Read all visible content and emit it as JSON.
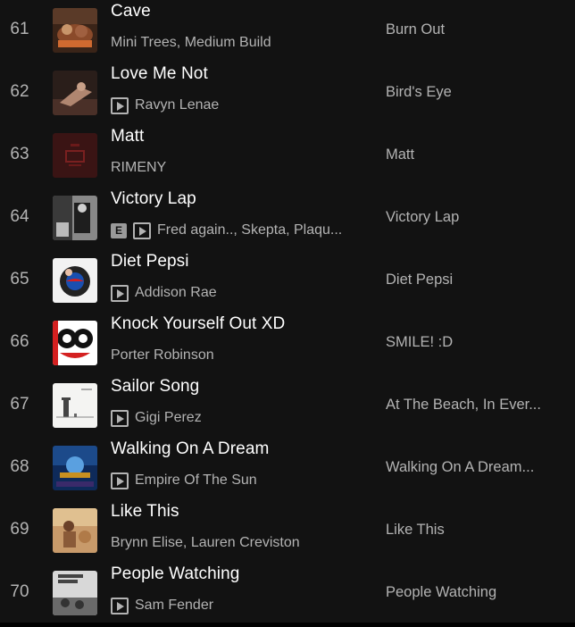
{
  "tracks": [
    {
      "number": "61",
      "title": "Cave",
      "artists": "Mini Trees, Medium Build",
      "album": "Burn Out",
      "explicit": false,
      "video": false
    },
    {
      "number": "62",
      "title": "Love Me Not",
      "artists": "Ravyn Lenae",
      "album": "Bird's Eye",
      "explicit": false,
      "video": true
    },
    {
      "number": "63",
      "title": "Matt",
      "artists": "RIMENY",
      "album": "Matt",
      "explicit": false,
      "video": false
    },
    {
      "number": "64",
      "title": "Victory Lap",
      "artists": "Fred again.., Skepta, Plaqu...",
      "album": "Victory Lap",
      "explicit": true,
      "video": true,
      "explicit_label": "E"
    },
    {
      "number": "65",
      "title": "Diet Pepsi",
      "artists": "Addison Rae",
      "album": "Diet Pepsi",
      "explicit": false,
      "video": true
    },
    {
      "number": "66",
      "title": "Knock Yourself Out XD",
      "artists": "Porter Robinson",
      "album": "SMILE! :D",
      "explicit": false,
      "video": false
    },
    {
      "number": "67",
      "title": "Sailor Song",
      "artists": "Gigi Perez",
      "album": "At The Beach, In Ever...",
      "explicit": false,
      "video": true
    },
    {
      "number": "68",
      "title": "Walking On A Dream",
      "artists": "Empire Of The Sun",
      "album": "Walking On A Dream...",
      "explicit": false,
      "video": true
    },
    {
      "number": "69",
      "title": "Like This",
      "artists": "Brynn Elise, Lauren Creviston",
      "album": "Like This",
      "explicit": false,
      "video": false
    },
    {
      "number": "70",
      "title": "People Watching",
      "artists": "Sam Fender",
      "album": "People Watching",
      "explicit": false,
      "video": true
    }
  ],
  "colors": {
    "background": "#121212",
    "primary_text": "#ffffff",
    "secondary_text": "#b3b3b3",
    "explicit_badge": "#9a9a9a"
  },
  "icons": {
    "video": "music-video-icon",
    "explicit": "explicit-badge"
  }
}
